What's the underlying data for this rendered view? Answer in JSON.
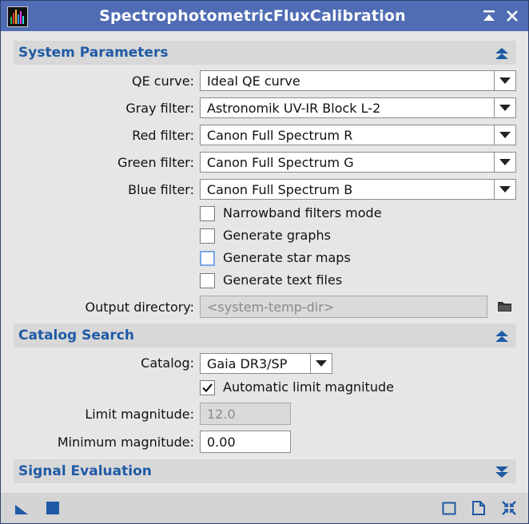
{
  "window": {
    "title": "SpectrophotometricFluxCalibration"
  },
  "sections": {
    "system": {
      "title": "System Parameters",
      "expanded": true
    },
    "catalog": {
      "title": "Catalog Search",
      "expanded": true
    },
    "signal": {
      "title": "Signal Evaluation",
      "expanded": false
    }
  },
  "system": {
    "qe_curve": {
      "label": "QE curve:",
      "value": "Ideal QE curve"
    },
    "gray_filter": {
      "label": "Gray filter:",
      "value": "Astronomik UV-IR Block L-2"
    },
    "red_filter": {
      "label": "Red filter:",
      "value": "Canon Full Spectrum R"
    },
    "green_filter": {
      "label": "Green filter:",
      "value": "Canon Full Spectrum G"
    },
    "blue_filter": {
      "label": "Blue filter:",
      "value": "Canon Full Spectrum B"
    },
    "checkboxes": {
      "narrowband": {
        "label": "Narrowband filters mode",
        "checked": false
      },
      "graphs": {
        "label": "Generate graphs",
        "checked": false
      },
      "star_maps": {
        "label": "Generate star maps",
        "checked": false,
        "focused": true
      },
      "text_files": {
        "label": "Generate text files",
        "checked": false
      }
    },
    "output_directory": {
      "label": "Output directory:",
      "placeholder": "<system-temp-dir>"
    }
  },
  "catalog": {
    "catalog": {
      "label": "Catalog:",
      "value": "Gaia DR3/SP"
    },
    "auto_limit": {
      "label": "Automatic limit magnitude",
      "checked": true
    },
    "limit_magnitude": {
      "label": "Limit magnitude:",
      "value": "12.0",
      "enabled": false
    },
    "minimum_magnitude": {
      "label": "Minimum magnitude:",
      "value": "0.00"
    }
  },
  "colors": {
    "titlebar": "#4f6cb4",
    "section_title": "#1f5aa5",
    "accent_icon": "#1f5aa5"
  }
}
